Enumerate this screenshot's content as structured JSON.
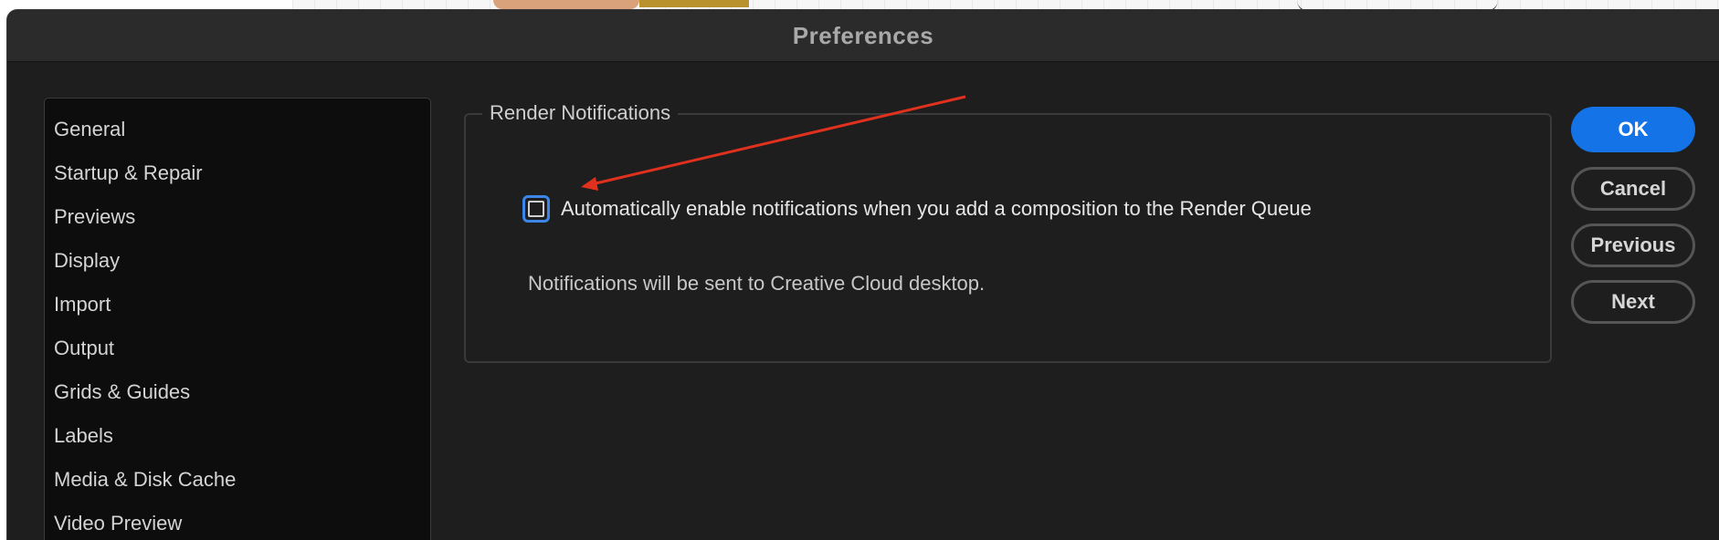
{
  "window": {
    "title": "Preferences"
  },
  "sidebar": {
    "items": [
      {
        "label": "General"
      },
      {
        "label": "Startup & Repair"
      },
      {
        "label": "Previews"
      },
      {
        "label": "Display"
      },
      {
        "label": "Import"
      },
      {
        "label": "Output"
      },
      {
        "label": "Grids & Guides"
      },
      {
        "label": "Labels"
      },
      {
        "label": "Media & Disk Cache"
      },
      {
        "label": "Video Preview"
      }
    ]
  },
  "panel": {
    "legend": "Render Notifications",
    "checkbox_label": "Automatically enable notifications when you add a composition to the Render Queue",
    "checkbox_checked": false,
    "note": "Notifications will be sent to Creative Cloud desktop."
  },
  "buttons": {
    "ok": "OK",
    "cancel": "Cancel",
    "previous": "Previous",
    "next": "Next"
  },
  "colors": {
    "accent": "#1473e6",
    "focus_ring": "#3b86e8",
    "annotation_arrow": "#e0301e",
    "dialog_bg": "#1e1e1e"
  }
}
